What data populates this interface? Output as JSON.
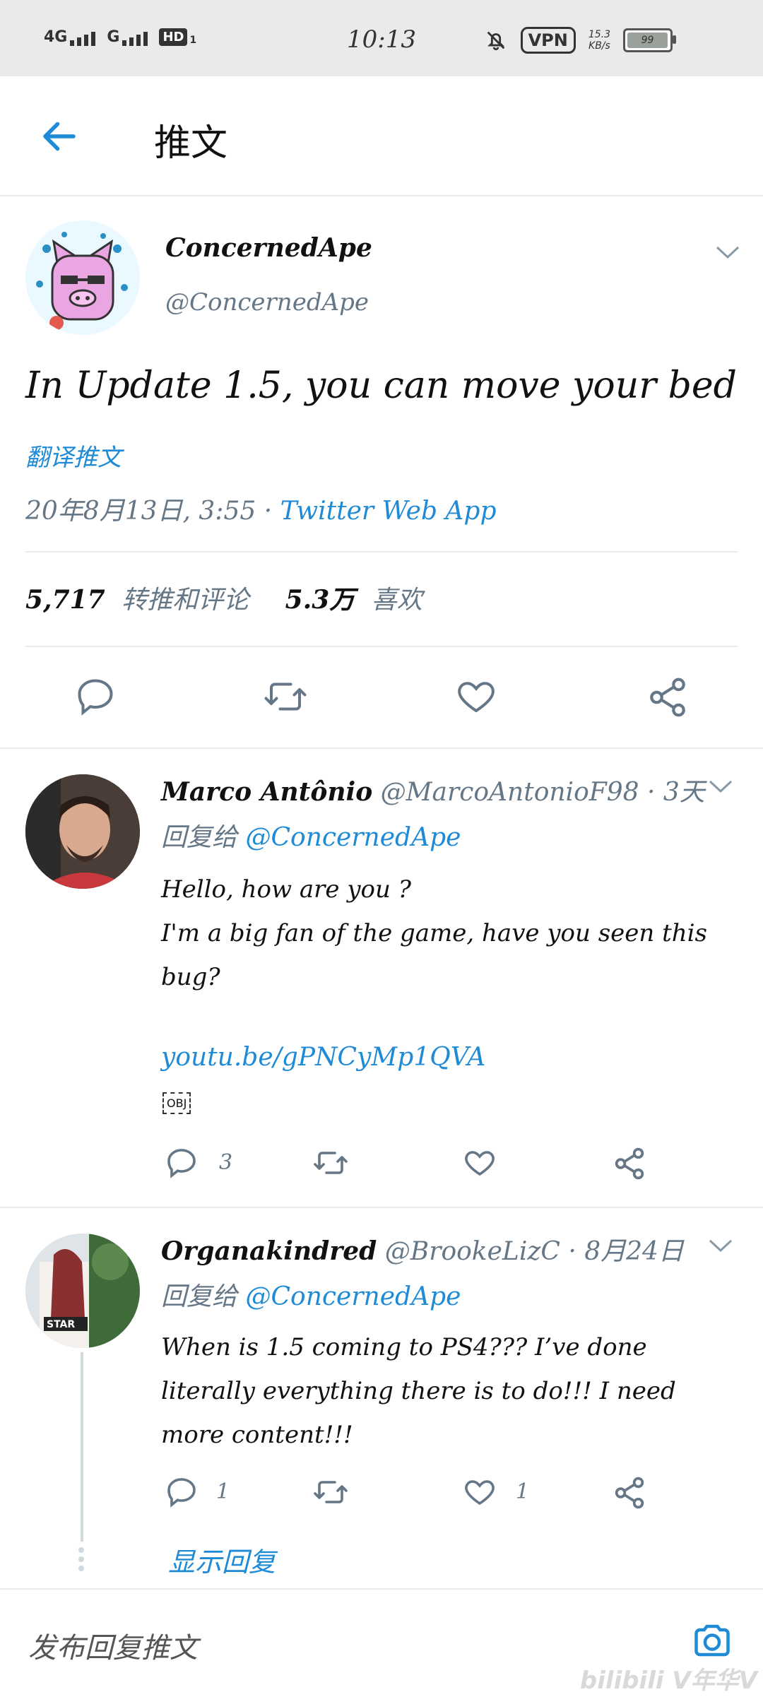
{
  "status_bar": {
    "net1": "4G",
    "net2": "G",
    "hd": "HD",
    "hd_sub": "1",
    "time": "10:13",
    "vpn": "VPN",
    "speed_value": "15.3",
    "speed_unit": "KB/s",
    "battery": "99"
  },
  "header": {
    "title": "推文"
  },
  "main_tweet": {
    "display_name": "ConcernedApe",
    "handle": "@ConcernedApe",
    "text": "In Update 1.5, you can move your bed",
    "translate": "翻译推文",
    "date": "20年8月13日, 3:55",
    "separator": "·",
    "source": "Twitter Web App",
    "retweets_count": "5,717",
    "retweets_label": "转推和评论",
    "likes_count": "5.3万",
    "likes_label": "喜欢"
  },
  "replies": [
    {
      "display_name": "Marco Antônio",
      "handle": "@MarcoAntonioF98",
      "time": "· 3天",
      "reply_prefix": "回复给",
      "reply_to": "@ConcernedApe",
      "line1": "Hello, how are you ?",
      "line2": "I'm a big fan of the game, have you seen this",
      "line3": "bug?",
      "link": "youtu.be/gPNCyMp1QVA",
      "obj": "OBJ",
      "reply_count": "3",
      "like_count": ""
    },
    {
      "display_name": "Organakindred",
      "handle": "@BrookeLizC",
      "time": "· 8月24日",
      "reply_prefix": "回复给",
      "reply_to": "@ConcernedApe",
      "line1": "When is 1.5 coming to PS4??? I’ve done",
      "line2": "literally everything there is to do!!! I need",
      "line3": "more content!!!",
      "reply_count": "1",
      "like_count": "1",
      "show_replies": "显示回复"
    }
  ],
  "compose": {
    "placeholder": "发布回复推文"
  },
  "watermark": "bilibili V年华V",
  "colors": {
    "accent": "#1f8ad6",
    "secondary_text": "#657786",
    "divider": "#e6ecf0",
    "status_bar_bg": "#ece9ec"
  }
}
